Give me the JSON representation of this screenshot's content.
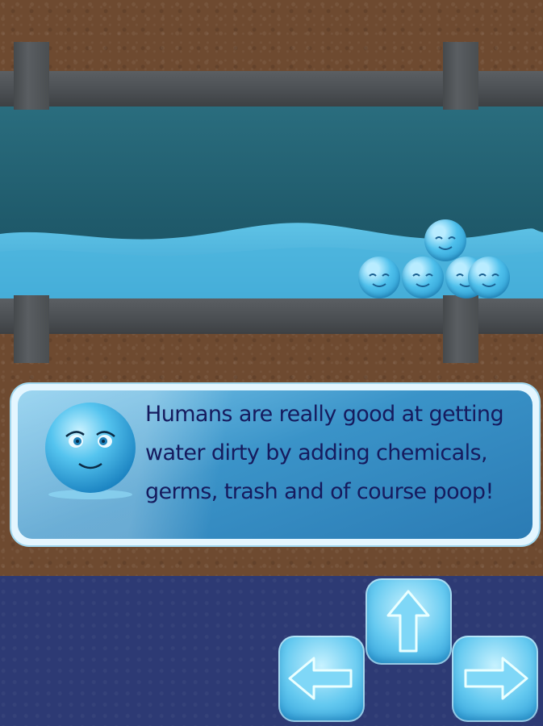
{
  "scene": {
    "message_lines": [
      "Humans are really good at getting",
      "water dirty by adding chemicals,",
      "germs, trash and of course poop!"
    ]
  },
  "colors": {
    "dirt": "#6e4a30",
    "pipe": "#4a4e52",
    "water": "#4ab4dd",
    "night_ground": "#2d3a74",
    "text": "#161b5e"
  },
  "controls": {
    "up": "arrow-up-icon",
    "left": "arrow-left-icon",
    "right": "arrow-right-icon"
  }
}
